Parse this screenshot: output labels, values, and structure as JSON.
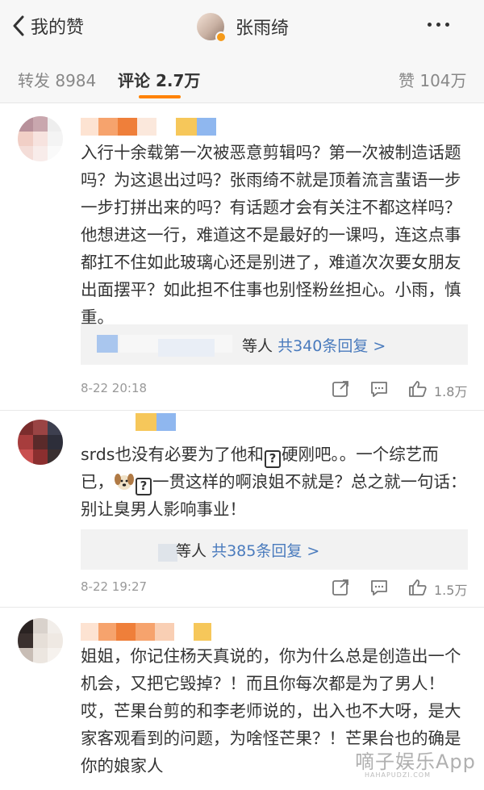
{
  "nav": {
    "back_label": "我的赞",
    "title": "张雨绮"
  },
  "tabs": {
    "repost": "转发 8984",
    "comment": "评论 2.7万",
    "like": "赞 104万"
  },
  "comments": [
    {
      "text": "入行十余载第一次被恶意剪辑吗？第一次被制造话题吗？为这退出过吗？张雨绮不就是顶着流言蜚语一步一步打拼出来的吗？有话题才会有关注不都这样吗？他想进这一行，难道这不是最好的一课吗，连这点事都扛不住如此玻璃心还是别进了，难道次次要女朋友出面摆平？如此担不住事也别怪粉丝担心。小雨，慎重。",
      "reply_prefix": "等人",
      "reply_link": "共340条回复 >",
      "time": "8-22 20:18",
      "likes": "1.8万"
    },
    {
      "text_part1": "srds也没有必要为了他和",
      "text_part2": "硬刚吧。。一个综艺而已，",
      "text_part3": "一贯这样的啊浪姐不就是？总之就一句话：别让臭男人影响事业！",
      "qmark": "?",
      "reply_prefix": "等人",
      "reply_link": "共385条回复 >",
      "time": "8-22 19:27",
      "likes": "1.5万"
    },
    {
      "text": "姐姐，你记住杨天真说的，你为什么总是创造出一个机会，又把它毁掉？！而且你每次都是为了男人！哎，芒果台剪的和李老师说的，出入也不大呀，是大家客观看到的问题，为啥怪芒果？！芒果台也的确是你的娘家人"
    }
  ],
  "icons": {
    "back": "chevron-left-icon",
    "more": "more-dots-icon",
    "share": "share-icon",
    "reply": "comment-icon",
    "like": "thumbs-up-icon",
    "emoji": "dog-emoji-icon"
  },
  "watermark": {
    "main": "嘀子娱乐App",
    "sub": "HAHAPUDZI.COM"
  },
  "colors": {
    "accent": "#ff8200",
    "link": "#4a7bbd",
    "verified": "#f59a1a"
  }
}
